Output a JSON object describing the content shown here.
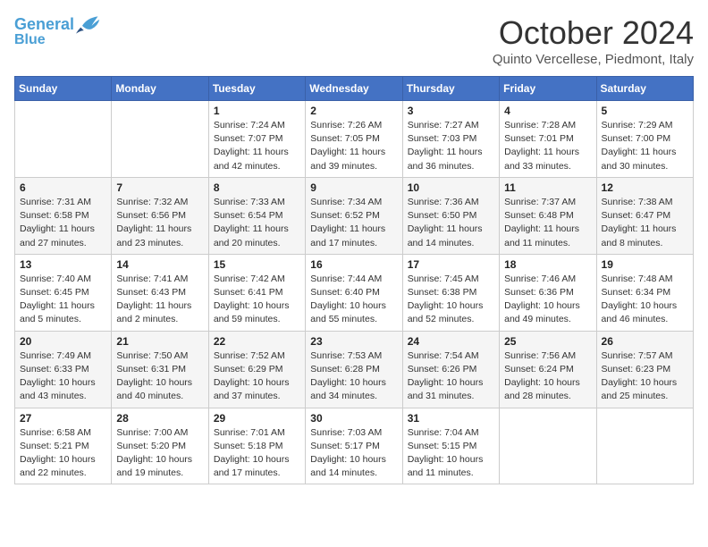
{
  "header": {
    "logo_line1": "General",
    "logo_line2": "Blue",
    "month": "October 2024",
    "location": "Quinto Vercellese, Piedmont, Italy"
  },
  "days_of_week": [
    "Sunday",
    "Monday",
    "Tuesday",
    "Wednesday",
    "Thursday",
    "Friday",
    "Saturday"
  ],
  "weeks": [
    [
      {
        "day": "",
        "sunrise": "",
        "sunset": "",
        "daylight": ""
      },
      {
        "day": "",
        "sunrise": "",
        "sunset": "",
        "daylight": ""
      },
      {
        "day": "1",
        "sunrise": "Sunrise: 7:24 AM",
        "sunset": "Sunset: 7:07 PM",
        "daylight": "Daylight: 11 hours and 42 minutes."
      },
      {
        "day": "2",
        "sunrise": "Sunrise: 7:26 AM",
        "sunset": "Sunset: 7:05 PM",
        "daylight": "Daylight: 11 hours and 39 minutes."
      },
      {
        "day": "3",
        "sunrise": "Sunrise: 7:27 AM",
        "sunset": "Sunset: 7:03 PM",
        "daylight": "Daylight: 11 hours and 36 minutes."
      },
      {
        "day": "4",
        "sunrise": "Sunrise: 7:28 AM",
        "sunset": "Sunset: 7:01 PM",
        "daylight": "Daylight: 11 hours and 33 minutes."
      },
      {
        "day": "5",
        "sunrise": "Sunrise: 7:29 AM",
        "sunset": "Sunset: 7:00 PM",
        "daylight": "Daylight: 11 hours and 30 minutes."
      }
    ],
    [
      {
        "day": "6",
        "sunrise": "Sunrise: 7:31 AM",
        "sunset": "Sunset: 6:58 PM",
        "daylight": "Daylight: 11 hours and 27 minutes."
      },
      {
        "day": "7",
        "sunrise": "Sunrise: 7:32 AM",
        "sunset": "Sunset: 6:56 PM",
        "daylight": "Daylight: 11 hours and 23 minutes."
      },
      {
        "day": "8",
        "sunrise": "Sunrise: 7:33 AM",
        "sunset": "Sunset: 6:54 PM",
        "daylight": "Daylight: 11 hours and 20 minutes."
      },
      {
        "day": "9",
        "sunrise": "Sunrise: 7:34 AM",
        "sunset": "Sunset: 6:52 PM",
        "daylight": "Daylight: 11 hours and 17 minutes."
      },
      {
        "day": "10",
        "sunrise": "Sunrise: 7:36 AM",
        "sunset": "Sunset: 6:50 PM",
        "daylight": "Daylight: 11 hours and 14 minutes."
      },
      {
        "day": "11",
        "sunrise": "Sunrise: 7:37 AM",
        "sunset": "Sunset: 6:48 PM",
        "daylight": "Daylight: 11 hours and 11 minutes."
      },
      {
        "day": "12",
        "sunrise": "Sunrise: 7:38 AM",
        "sunset": "Sunset: 6:47 PM",
        "daylight": "Daylight: 11 hours and 8 minutes."
      }
    ],
    [
      {
        "day": "13",
        "sunrise": "Sunrise: 7:40 AM",
        "sunset": "Sunset: 6:45 PM",
        "daylight": "Daylight: 11 hours and 5 minutes."
      },
      {
        "day": "14",
        "sunrise": "Sunrise: 7:41 AM",
        "sunset": "Sunset: 6:43 PM",
        "daylight": "Daylight: 11 hours and 2 minutes."
      },
      {
        "day": "15",
        "sunrise": "Sunrise: 7:42 AM",
        "sunset": "Sunset: 6:41 PM",
        "daylight": "Daylight: 10 hours and 59 minutes."
      },
      {
        "day": "16",
        "sunrise": "Sunrise: 7:44 AM",
        "sunset": "Sunset: 6:40 PM",
        "daylight": "Daylight: 10 hours and 55 minutes."
      },
      {
        "day": "17",
        "sunrise": "Sunrise: 7:45 AM",
        "sunset": "Sunset: 6:38 PM",
        "daylight": "Daylight: 10 hours and 52 minutes."
      },
      {
        "day": "18",
        "sunrise": "Sunrise: 7:46 AM",
        "sunset": "Sunset: 6:36 PM",
        "daylight": "Daylight: 10 hours and 49 minutes."
      },
      {
        "day": "19",
        "sunrise": "Sunrise: 7:48 AM",
        "sunset": "Sunset: 6:34 PM",
        "daylight": "Daylight: 10 hours and 46 minutes."
      }
    ],
    [
      {
        "day": "20",
        "sunrise": "Sunrise: 7:49 AM",
        "sunset": "Sunset: 6:33 PM",
        "daylight": "Daylight: 10 hours and 43 minutes."
      },
      {
        "day": "21",
        "sunrise": "Sunrise: 7:50 AM",
        "sunset": "Sunset: 6:31 PM",
        "daylight": "Daylight: 10 hours and 40 minutes."
      },
      {
        "day": "22",
        "sunrise": "Sunrise: 7:52 AM",
        "sunset": "Sunset: 6:29 PM",
        "daylight": "Daylight: 10 hours and 37 minutes."
      },
      {
        "day": "23",
        "sunrise": "Sunrise: 7:53 AM",
        "sunset": "Sunset: 6:28 PM",
        "daylight": "Daylight: 10 hours and 34 minutes."
      },
      {
        "day": "24",
        "sunrise": "Sunrise: 7:54 AM",
        "sunset": "Sunset: 6:26 PM",
        "daylight": "Daylight: 10 hours and 31 minutes."
      },
      {
        "day": "25",
        "sunrise": "Sunrise: 7:56 AM",
        "sunset": "Sunset: 6:24 PM",
        "daylight": "Daylight: 10 hours and 28 minutes."
      },
      {
        "day": "26",
        "sunrise": "Sunrise: 7:57 AM",
        "sunset": "Sunset: 6:23 PM",
        "daylight": "Daylight: 10 hours and 25 minutes."
      }
    ],
    [
      {
        "day": "27",
        "sunrise": "Sunrise: 6:58 AM",
        "sunset": "Sunset: 5:21 PM",
        "daylight": "Daylight: 10 hours and 22 minutes."
      },
      {
        "day": "28",
        "sunrise": "Sunrise: 7:00 AM",
        "sunset": "Sunset: 5:20 PM",
        "daylight": "Daylight: 10 hours and 19 minutes."
      },
      {
        "day": "29",
        "sunrise": "Sunrise: 7:01 AM",
        "sunset": "Sunset: 5:18 PM",
        "daylight": "Daylight: 10 hours and 17 minutes."
      },
      {
        "day": "30",
        "sunrise": "Sunrise: 7:03 AM",
        "sunset": "Sunset: 5:17 PM",
        "daylight": "Daylight: 10 hours and 14 minutes."
      },
      {
        "day": "31",
        "sunrise": "Sunrise: 7:04 AM",
        "sunset": "Sunset: 5:15 PM",
        "daylight": "Daylight: 10 hours and 11 minutes."
      },
      {
        "day": "",
        "sunrise": "",
        "sunset": "",
        "daylight": ""
      },
      {
        "day": "",
        "sunrise": "",
        "sunset": "",
        "daylight": ""
      }
    ]
  ]
}
